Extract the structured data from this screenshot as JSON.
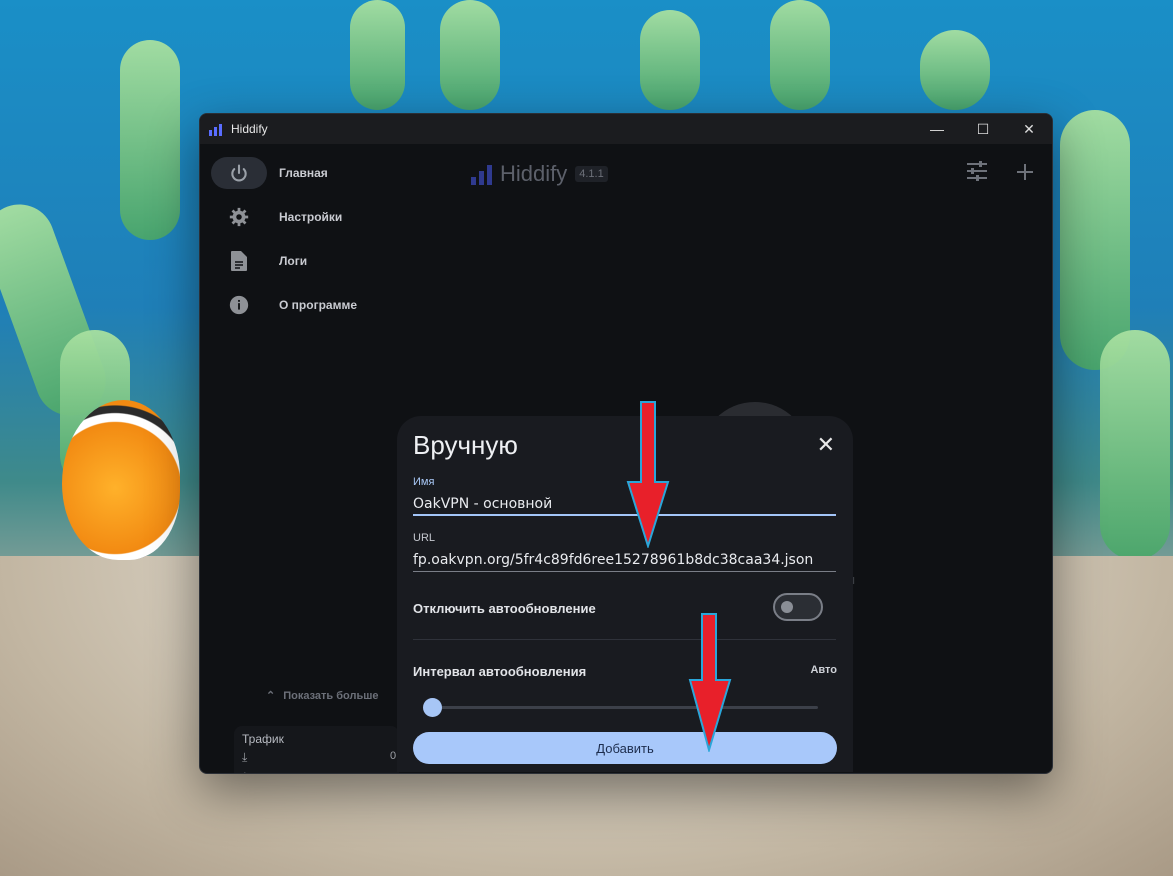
{
  "window": {
    "title": "Hiddify",
    "controls": {
      "minimize": "—",
      "maximize": "☐",
      "close": "✕"
    }
  },
  "sidebar": {
    "items": [
      {
        "label": "Главная",
        "icon": "power-icon",
        "active": true
      },
      {
        "label": "Настройки",
        "icon": "gear-icon",
        "active": false
      },
      {
        "label": "Логи",
        "icon": "document-icon",
        "active": false
      },
      {
        "label": "О программе",
        "icon": "info-icon",
        "active": false
      }
    ],
    "show_more": "Показать больше",
    "traffic": {
      "title": "Трафик",
      "download_value": "0"
    }
  },
  "header": {
    "brand": "Hiddify",
    "version": "4.1.1",
    "actions": [
      "sliders-icon",
      "plus-icon"
    ]
  },
  "dialog": {
    "title": "Вручную",
    "name_label": "Имя",
    "name_value": "OakVPN - основной",
    "url_label": "URL",
    "url_value": "fp.oakvpn.org/5fr4c89fd6ree15278961b8dc38caa34.json",
    "disable_autoupdate_label": "Отключить автообновление",
    "disable_autoupdate_on": false,
    "interval_label": "Интервал автообновления",
    "interval_value": "Авто",
    "add_button": "Добавить"
  },
  "background_text": "я",
  "colors": {
    "accent": "#a8c8fa",
    "annotation_arrow": "#e8202a",
    "window_bg": "#0f1114",
    "dialog_bg": "#191b20"
  }
}
